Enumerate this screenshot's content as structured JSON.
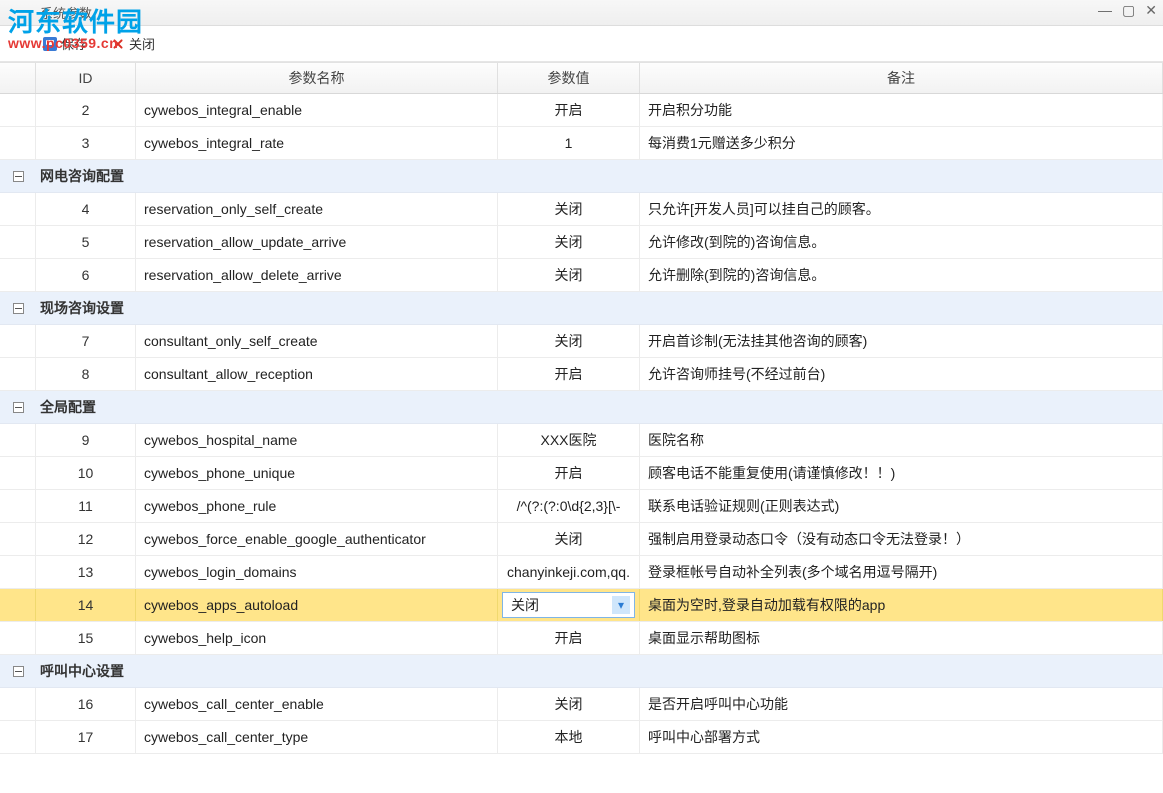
{
  "window": {
    "title": "系统参数"
  },
  "toolbar": {
    "save": "保存",
    "close": "关闭"
  },
  "columns": {
    "id": "ID",
    "name": "参数名称",
    "value": "参数值",
    "note": "备注"
  },
  "groups": [
    {
      "title": "",
      "rows": [
        {
          "id": "2",
          "name": "cywebos_integral_enable",
          "value": "开启",
          "note": "开启积分功能"
        },
        {
          "id": "3",
          "name": "cywebos_integral_rate",
          "value": "1",
          "note": "每消费1元赠送多少积分"
        }
      ]
    },
    {
      "title": "网电咨询配置",
      "rows": [
        {
          "id": "4",
          "name": "reservation_only_self_create",
          "value": "关闭",
          "note": "只允许[开发人员]可以挂自己的顾客。"
        },
        {
          "id": "5",
          "name": "reservation_allow_update_arrive",
          "value": "关闭",
          "note": "允许修改(到院的)咨询信息。"
        },
        {
          "id": "6",
          "name": "reservation_allow_delete_arrive",
          "value": "关闭",
          "note": "允许删除(到院的)咨询信息。"
        }
      ]
    },
    {
      "title": "现场咨询设置",
      "rows": [
        {
          "id": "7",
          "name": "consultant_only_self_create",
          "value": "关闭",
          "note": "开启首诊制(无法挂其他咨询的顾客)"
        },
        {
          "id": "8",
          "name": "consultant_allow_reception",
          "value": "开启",
          "note": "允许咨询师挂号(不经过前台)"
        }
      ]
    },
    {
      "title": "全局配置",
      "rows": [
        {
          "id": "9",
          "name": "cywebos_hospital_name",
          "value": "XXX医院",
          "note": "医院名称"
        },
        {
          "id": "10",
          "name": "cywebos_phone_unique",
          "value": "开启",
          "note": "顾客电话不能重复使用(请谨慎修改！！)"
        },
        {
          "id": "11",
          "name": "cywebos_phone_rule",
          "value": "/^(?:(?:0\\d{2,3}[\\-",
          "note": "联系电话验证规则(正则表达式)"
        },
        {
          "id": "12",
          "name": "cywebos_force_enable_google_authenticator",
          "value": "关闭",
          "note": "强制启用登录动态口令（没有动态口令无法登录！）"
        },
        {
          "id": "13",
          "name": "cywebos_login_domains",
          "value": "chanyinkeji.com,qq.",
          "note": "登录框帐号自动补全列表(多个域名用逗号隔开)"
        },
        {
          "id": "14",
          "name": "cywebos_apps_autoload",
          "value": "关闭",
          "note": "桌面为空时,登录自动加载有权限的app",
          "selected": true
        },
        {
          "id": "15",
          "name": "cywebos_help_icon",
          "value": "开启",
          "note": "桌面显示帮助图标"
        }
      ]
    },
    {
      "title": "呼叫中心设置",
      "rows": [
        {
          "id": "16",
          "name": "cywebos_call_center_enable",
          "value": "关闭",
          "note": "是否开启呼叫中心功能"
        },
        {
          "id": "17",
          "name": "cywebos_call_center_type",
          "value": "本地",
          "note": "呼叫中心部署方式"
        }
      ]
    }
  ],
  "watermark": {
    "brand": "河东软件园",
    "url": "www.pc0359.cn"
  }
}
